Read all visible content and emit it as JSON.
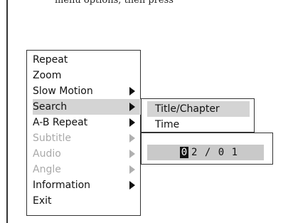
{
  "header": {
    "text": "menu options, then press"
  },
  "main_menu": {
    "items": [
      {
        "label": "Repeat",
        "state": "enabled",
        "has_submenu": false
      },
      {
        "label": "Zoom",
        "state": "enabled",
        "has_submenu": false
      },
      {
        "label": "Slow Motion",
        "state": "enabled",
        "has_submenu": true
      },
      {
        "label": "Search",
        "state": "selected",
        "has_submenu": true
      },
      {
        "label": "A-B Repeat",
        "state": "enabled",
        "has_submenu": true
      },
      {
        "label": "Subtitle",
        "state": "disabled",
        "has_submenu": true
      },
      {
        "label": "Audio",
        "state": "disabled",
        "has_submenu": true
      },
      {
        "label": "Angle",
        "state": "disabled",
        "has_submenu": true
      },
      {
        "label": "Information",
        "state": "enabled",
        "has_submenu": true
      },
      {
        "label": "Exit",
        "state": "enabled",
        "has_submenu": false
      }
    ]
  },
  "search_submenu": {
    "items": [
      {
        "label": "Title/Chapter",
        "state": "selected"
      },
      {
        "label": "Time",
        "state": "enabled"
      }
    ]
  },
  "search_input": {
    "cursor_digit": "0",
    "rest": "2 / 0 1"
  },
  "colors": {
    "selection": "#d4d4d4",
    "disabled_text": "#a9a9a9",
    "input_background": "#c9c9c9"
  },
  "icons": {
    "submenu_arrow": "right-triangle-icon"
  }
}
